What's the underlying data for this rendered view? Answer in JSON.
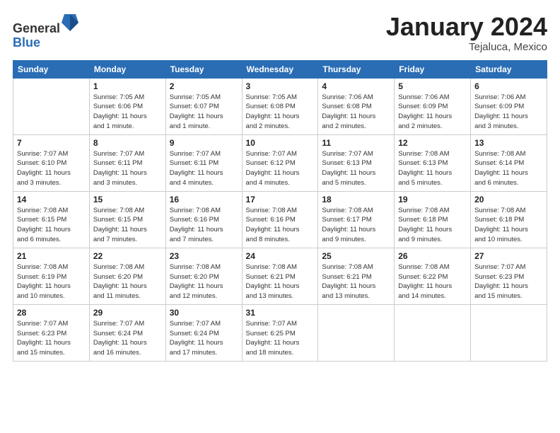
{
  "header": {
    "title": "January 2024",
    "location": "Tejaluca, Mexico",
    "logo_general": "General",
    "logo_blue": "Blue"
  },
  "columns": [
    "Sunday",
    "Monday",
    "Tuesday",
    "Wednesday",
    "Thursday",
    "Friday",
    "Saturday"
  ],
  "weeks": [
    [
      {
        "day": "",
        "info": ""
      },
      {
        "day": "1",
        "info": "Sunrise: 7:05 AM\nSunset: 6:06 PM\nDaylight: 11 hours\nand 1 minute."
      },
      {
        "day": "2",
        "info": "Sunrise: 7:05 AM\nSunset: 6:07 PM\nDaylight: 11 hours\nand 1 minute."
      },
      {
        "day": "3",
        "info": "Sunrise: 7:05 AM\nSunset: 6:08 PM\nDaylight: 11 hours\nand 2 minutes."
      },
      {
        "day": "4",
        "info": "Sunrise: 7:06 AM\nSunset: 6:08 PM\nDaylight: 11 hours\nand 2 minutes."
      },
      {
        "day": "5",
        "info": "Sunrise: 7:06 AM\nSunset: 6:09 PM\nDaylight: 11 hours\nand 2 minutes."
      },
      {
        "day": "6",
        "info": "Sunrise: 7:06 AM\nSunset: 6:09 PM\nDaylight: 11 hours\nand 3 minutes."
      }
    ],
    [
      {
        "day": "7",
        "info": "Sunrise: 7:07 AM\nSunset: 6:10 PM\nDaylight: 11 hours\nand 3 minutes."
      },
      {
        "day": "8",
        "info": "Sunrise: 7:07 AM\nSunset: 6:11 PM\nDaylight: 11 hours\nand 3 minutes."
      },
      {
        "day": "9",
        "info": "Sunrise: 7:07 AM\nSunset: 6:11 PM\nDaylight: 11 hours\nand 4 minutes."
      },
      {
        "day": "10",
        "info": "Sunrise: 7:07 AM\nSunset: 6:12 PM\nDaylight: 11 hours\nand 4 minutes."
      },
      {
        "day": "11",
        "info": "Sunrise: 7:07 AM\nSunset: 6:13 PM\nDaylight: 11 hours\nand 5 minutes."
      },
      {
        "day": "12",
        "info": "Sunrise: 7:08 AM\nSunset: 6:13 PM\nDaylight: 11 hours\nand 5 minutes."
      },
      {
        "day": "13",
        "info": "Sunrise: 7:08 AM\nSunset: 6:14 PM\nDaylight: 11 hours\nand 6 minutes."
      }
    ],
    [
      {
        "day": "14",
        "info": "Sunrise: 7:08 AM\nSunset: 6:15 PM\nDaylight: 11 hours\nand 6 minutes."
      },
      {
        "day": "15",
        "info": "Sunrise: 7:08 AM\nSunset: 6:15 PM\nDaylight: 11 hours\nand 7 minutes."
      },
      {
        "day": "16",
        "info": "Sunrise: 7:08 AM\nSunset: 6:16 PM\nDaylight: 11 hours\nand 7 minutes."
      },
      {
        "day": "17",
        "info": "Sunrise: 7:08 AM\nSunset: 6:16 PM\nDaylight: 11 hours\nand 8 minutes."
      },
      {
        "day": "18",
        "info": "Sunrise: 7:08 AM\nSunset: 6:17 PM\nDaylight: 11 hours\nand 9 minutes."
      },
      {
        "day": "19",
        "info": "Sunrise: 7:08 AM\nSunset: 6:18 PM\nDaylight: 11 hours\nand 9 minutes."
      },
      {
        "day": "20",
        "info": "Sunrise: 7:08 AM\nSunset: 6:18 PM\nDaylight: 11 hours\nand 10 minutes."
      }
    ],
    [
      {
        "day": "21",
        "info": "Sunrise: 7:08 AM\nSunset: 6:19 PM\nDaylight: 11 hours\nand 10 minutes."
      },
      {
        "day": "22",
        "info": "Sunrise: 7:08 AM\nSunset: 6:20 PM\nDaylight: 11 hours\nand 11 minutes."
      },
      {
        "day": "23",
        "info": "Sunrise: 7:08 AM\nSunset: 6:20 PM\nDaylight: 11 hours\nand 12 minutes."
      },
      {
        "day": "24",
        "info": "Sunrise: 7:08 AM\nSunset: 6:21 PM\nDaylight: 11 hours\nand 13 minutes."
      },
      {
        "day": "25",
        "info": "Sunrise: 7:08 AM\nSunset: 6:21 PM\nDaylight: 11 hours\nand 13 minutes."
      },
      {
        "day": "26",
        "info": "Sunrise: 7:08 AM\nSunset: 6:22 PM\nDaylight: 11 hours\nand 14 minutes."
      },
      {
        "day": "27",
        "info": "Sunrise: 7:07 AM\nSunset: 6:23 PM\nDaylight: 11 hours\nand 15 minutes."
      }
    ],
    [
      {
        "day": "28",
        "info": "Sunrise: 7:07 AM\nSunset: 6:23 PM\nDaylight: 11 hours\nand 15 minutes."
      },
      {
        "day": "29",
        "info": "Sunrise: 7:07 AM\nSunset: 6:24 PM\nDaylight: 11 hours\nand 16 minutes."
      },
      {
        "day": "30",
        "info": "Sunrise: 7:07 AM\nSunset: 6:24 PM\nDaylight: 11 hours\nand 17 minutes."
      },
      {
        "day": "31",
        "info": "Sunrise: 7:07 AM\nSunset: 6:25 PM\nDaylight: 11 hours\nand 18 minutes."
      },
      {
        "day": "",
        "info": ""
      },
      {
        "day": "",
        "info": ""
      },
      {
        "day": "",
        "info": ""
      }
    ]
  ]
}
